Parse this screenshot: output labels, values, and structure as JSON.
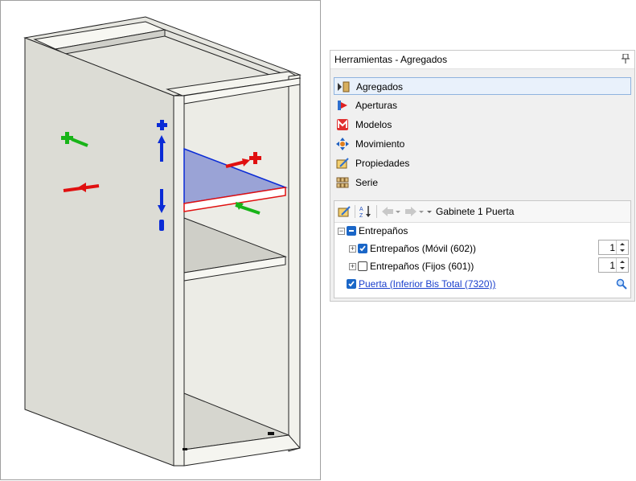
{
  "panel": {
    "title": "Herramientas - Agregados",
    "nav_items": [
      {
        "label": "Agregados",
        "icon": "agregados-icon",
        "active": true
      },
      {
        "label": "Aperturas",
        "icon": "aperturas-icon"
      },
      {
        "label": "Modelos",
        "icon": "modelos-icon"
      },
      {
        "label": "Movimiento",
        "icon": "movimiento-icon"
      },
      {
        "label": "Propiedades",
        "icon": "propiedades-icon"
      },
      {
        "label": "Serie",
        "icon": "serie-icon"
      }
    ],
    "toolbar": {
      "breadcrumb": "Gabinete 1 Puerta"
    },
    "tree": {
      "group_label": "Entrepaños",
      "items": [
        {
          "label": "Entrepaños (Móvil (602))",
          "checked": true,
          "quantity": "1"
        },
        {
          "label": "Entrepaños (Fijos (601))",
          "checked": false,
          "quantity": "1"
        }
      ],
      "link_item": {
        "label": "Puerta (Inferior Bis Total (7320))",
        "checked": true
      }
    }
  },
  "colors": {
    "accent": "#1a66c7",
    "manip_blue": "#0a2bd6",
    "manip_red": "#e01010",
    "manip_green": "#18b418",
    "shelf_selected": "#9aa3d6"
  }
}
